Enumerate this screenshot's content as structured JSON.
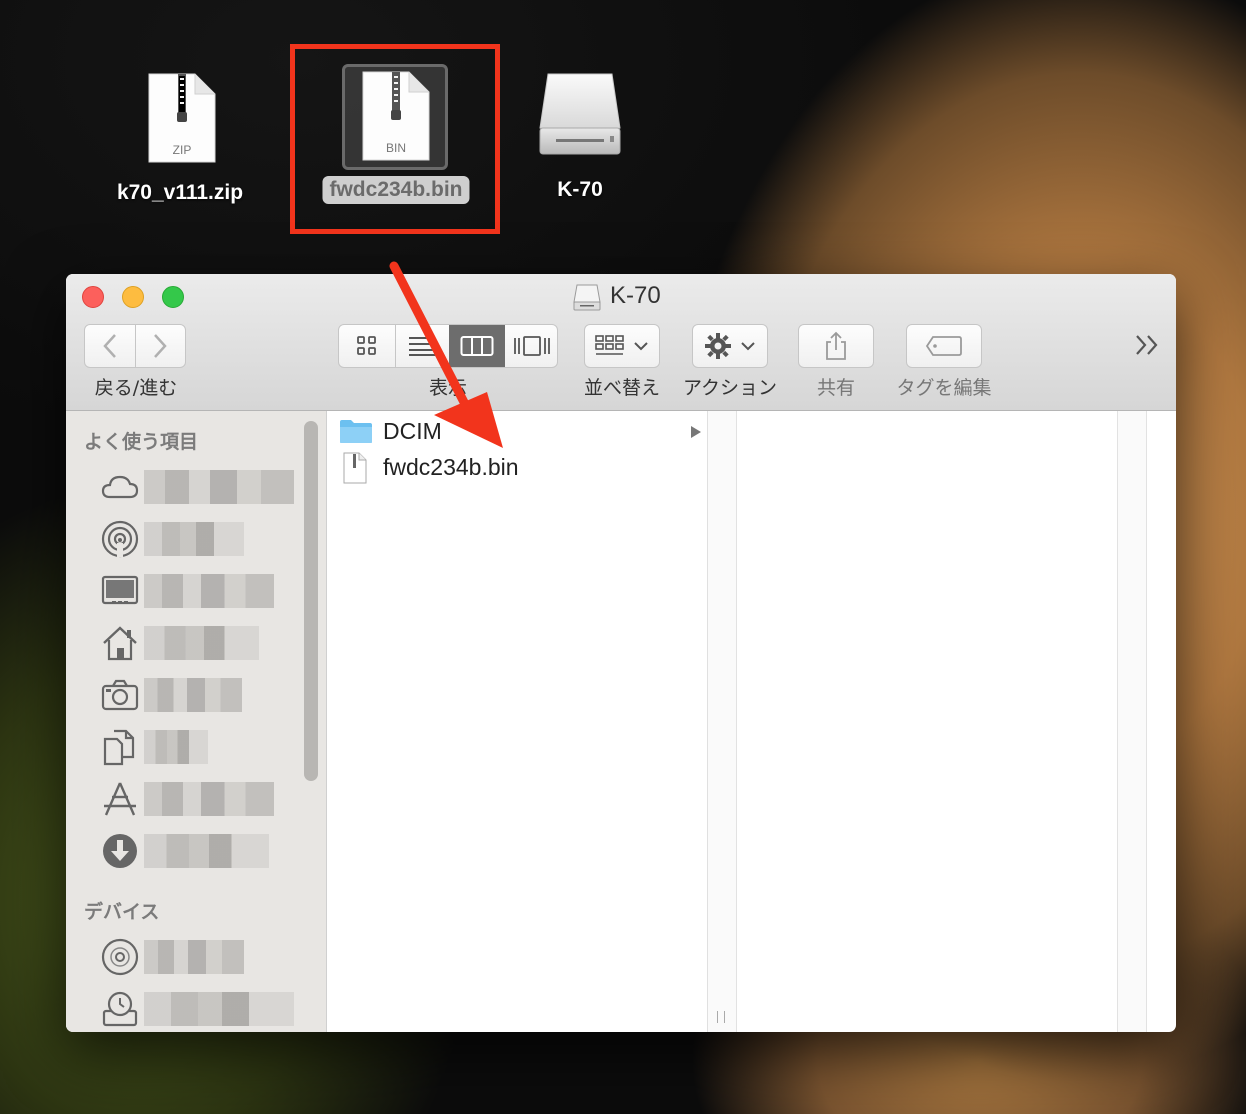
{
  "desktop": {
    "items": [
      {
        "label": "k70_v111.zip",
        "icon_text": "ZIP",
        "icon": "zip-archive-icon"
      },
      {
        "label": "fwdc234b.bin",
        "icon_text": "BIN",
        "icon": "bin-file-icon",
        "selected": true
      },
      {
        "label": "K-70",
        "icon": "external-drive-icon"
      }
    ]
  },
  "window": {
    "title": "K-70",
    "title_icon": "drive-icon",
    "toolbar": {
      "back_forward_label": "戻る/進む",
      "view_label": "表示",
      "arrange_label": "並べ替え",
      "action_label": "アクション",
      "share_label": "共有",
      "tags_label": "タグを編集",
      "overflow_label": ">>"
    },
    "sidebar": {
      "favorites_header": "よく使う項目",
      "devices_header": "デバイス",
      "favorites": [
        {
          "icon": "icloud-icon"
        },
        {
          "icon": "airdrop-icon"
        },
        {
          "icon": "desktop-icon"
        },
        {
          "icon": "home-icon"
        },
        {
          "icon": "camera-icon"
        },
        {
          "icon": "documents-icon"
        },
        {
          "icon": "applications-icon"
        },
        {
          "icon": "downloads-icon"
        }
      ],
      "devices": [
        {
          "icon": "disc-icon"
        },
        {
          "icon": "time-machine-icon"
        }
      ]
    },
    "column1": [
      {
        "name": "DCIM",
        "kind": "folder"
      },
      {
        "name": "fwdc234b.bin",
        "kind": "file"
      }
    ]
  },
  "colors": {
    "highlight_box": "#f2341c",
    "arrow": "#f2341c",
    "close": "#fc605c",
    "minimize": "#fdbc40",
    "zoom": "#34c84a",
    "folder": "#6cc0f0"
  }
}
